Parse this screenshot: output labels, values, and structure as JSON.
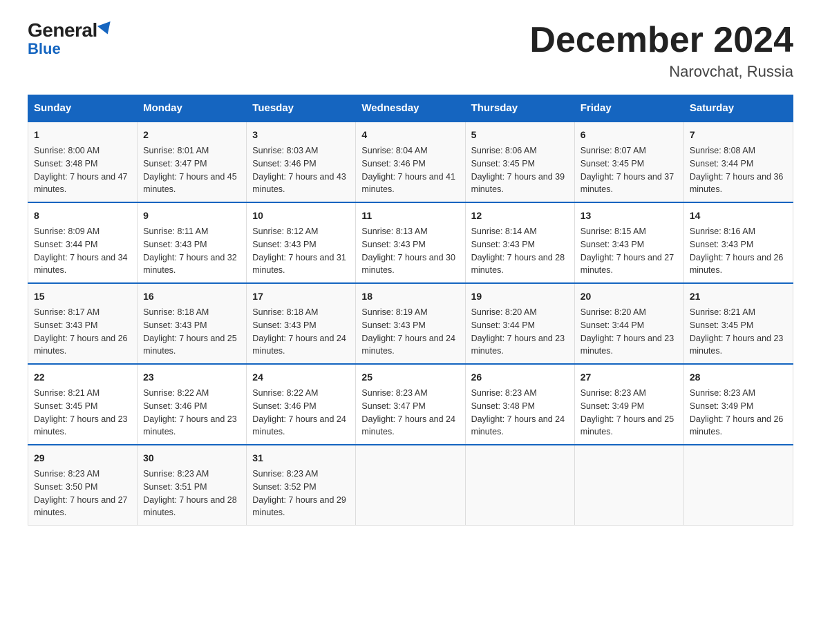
{
  "logo": {
    "general": "General",
    "blue": "Blue"
  },
  "title": "December 2024",
  "subtitle": "Narovchat, Russia",
  "days_of_week": [
    "Sunday",
    "Monday",
    "Tuesday",
    "Wednesday",
    "Thursday",
    "Friday",
    "Saturday"
  ],
  "weeks": [
    [
      {
        "date": "1",
        "sunrise": "8:00 AM",
        "sunset": "3:48 PM",
        "daylight": "7 hours and 47 minutes."
      },
      {
        "date": "2",
        "sunrise": "8:01 AM",
        "sunset": "3:47 PM",
        "daylight": "7 hours and 45 minutes."
      },
      {
        "date": "3",
        "sunrise": "8:03 AM",
        "sunset": "3:46 PM",
        "daylight": "7 hours and 43 minutes."
      },
      {
        "date": "4",
        "sunrise": "8:04 AM",
        "sunset": "3:46 PM",
        "daylight": "7 hours and 41 minutes."
      },
      {
        "date": "5",
        "sunrise": "8:06 AM",
        "sunset": "3:45 PM",
        "daylight": "7 hours and 39 minutes."
      },
      {
        "date": "6",
        "sunrise": "8:07 AM",
        "sunset": "3:45 PM",
        "daylight": "7 hours and 37 minutes."
      },
      {
        "date": "7",
        "sunrise": "8:08 AM",
        "sunset": "3:44 PM",
        "daylight": "7 hours and 36 minutes."
      }
    ],
    [
      {
        "date": "8",
        "sunrise": "8:09 AM",
        "sunset": "3:44 PM",
        "daylight": "7 hours and 34 minutes."
      },
      {
        "date": "9",
        "sunrise": "8:11 AM",
        "sunset": "3:43 PM",
        "daylight": "7 hours and 32 minutes."
      },
      {
        "date": "10",
        "sunrise": "8:12 AM",
        "sunset": "3:43 PM",
        "daylight": "7 hours and 31 minutes."
      },
      {
        "date": "11",
        "sunrise": "8:13 AM",
        "sunset": "3:43 PM",
        "daylight": "7 hours and 30 minutes."
      },
      {
        "date": "12",
        "sunrise": "8:14 AM",
        "sunset": "3:43 PM",
        "daylight": "7 hours and 28 minutes."
      },
      {
        "date": "13",
        "sunrise": "8:15 AM",
        "sunset": "3:43 PM",
        "daylight": "7 hours and 27 minutes."
      },
      {
        "date": "14",
        "sunrise": "8:16 AM",
        "sunset": "3:43 PM",
        "daylight": "7 hours and 26 minutes."
      }
    ],
    [
      {
        "date": "15",
        "sunrise": "8:17 AM",
        "sunset": "3:43 PM",
        "daylight": "7 hours and 26 minutes."
      },
      {
        "date": "16",
        "sunrise": "8:18 AM",
        "sunset": "3:43 PM",
        "daylight": "7 hours and 25 minutes."
      },
      {
        "date": "17",
        "sunrise": "8:18 AM",
        "sunset": "3:43 PM",
        "daylight": "7 hours and 24 minutes."
      },
      {
        "date": "18",
        "sunrise": "8:19 AM",
        "sunset": "3:43 PM",
        "daylight": "7 hours and 24 minutes."
      },
      {
        "date": "19",
        "sunrise": "8:20 AM",
        "sunset": "3:44 PM",
        "daylight": "7 hours and 23 minutes."
      },
      {
        "date": "20",
        "sunrise": "8:20 AM",
        "sunset": "3:44 PM",
        "daylight": "7 hours and 23 minutes."
      },
      {
        "date": "21",
        "sunrise": "8:21 AM",
        "sunset": "3:45 PM",
        "daylight": "7 hours and 23 minutes."
      }
    ],
    [
      {
        "date": "22",
        "sunrise": "8:21 AM",
        "sunset": "3:45 PM",
        "daylight": "7 hours and 23 minutes."
      },
      {
        "date": "23",
        "sunrise": "8:22 AM",
        "sunset": "3:46 PM",
        "daylight": "7 hours and 23 minutes."
      },
      {
        "date": "24",
        "sunrise": "8:22 AM",
        "sunset": "3:46 PM",
        "daylight": "7 hours and 24 minutes."
      },
      {
        "date": "25",
        "sunrise": "8:23 AM",
        "sunset": "3:47 PM",
        "daylight": "7 hours and 24 minutes."
      },
      {
        "date": "26",
        "sunrise": "8:23 AM",
        "sunset": "3:48 PM",
        "daylight": "7 hours and 24 minutes."
      },
      {
        "date": "27",
        "sunrise": "8:23 AM",
        "sunset": "3:49 PM",
        "daylight": "7 hours and 25 minutes."
      },
      {
        "date": "28",
        "sunrise": "8:23 AM",
        "sunset": "3:49 PM",
        "daylight": "7 hours and 26 minutes."
      }
    ],
    [
      {
        "date": "29",
        "sunrise": "8:23 AM",
        "sunset": "3:50 PM",
        "daylight": "7 hours and 27 minutes."
      },
      {
        "date": "30",
        "sunrise": "8:23 AM",
        "sunset": "3:51 PM",
        "daylight": "7 hours and 28 minutes."
      },
      {
        "date": "31",
        "sunrise": "8:23 AM",
        "sunset": "3:52 PM",
        "daylight": "7 hours and 29 minutes."
      },
      null,
      null,
      null,
      null
    ]
  ]
}
